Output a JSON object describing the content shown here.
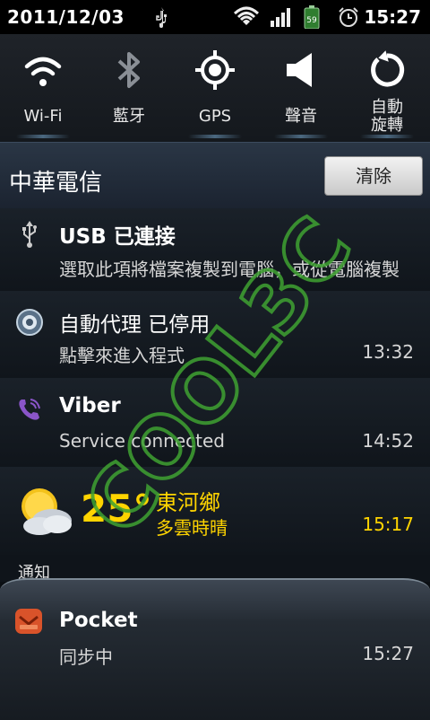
{
  "status_bar": {
    "date": "2011/12/03",
    "battery": "59",
    "time": "15:27"
  },
  "toggles": [
    {
      "label": "Wi-Fi",
      "icon": "wifi-icon"
    },
    {
      "label": "藍牙",
      "icon": "bluetooth-icon"
    },
    {
      "label": "GPS",
      "icon": "gps-icon"
    },
    {
      "label": "聲音",
      "icon": "sound-icon"
    },
    {
      "label": "自動\n旋轉",
      "icon": "rotate-icon"
    }
  ],
  "carrier": {
    "name": "中華電信",
    "clear_label": "清除"
  },
  "notifications": {
    "usb": {
      "title": "USB 已連接",
      "subtitle": "選取此項將檔案複製到電腦，或從電腦複製"
    },
    "proxy": {
      "title": "自動代理 已停用",
      "subtitle": "點擊來進入程式",
      "time": "13:32"
    },
    "viber": {
      "title": "Viber",
      "subtitle": "Service connected",
      "time": "14:52"
    }
  },
  "weather": {
    "temp": "25°",
    "place": "東河鄉",
    "condition": "多雲時晴",
    "time": "15:17"
  },
  "section": {
    "label": "通知"
  },
  "pocket": {
    "title": "Pocket",
    "subtitle": "同步中",
    "time": "15:27"
  },
  "watermark": {
    "text": "COOL3C"
  },
  "colors": {
    "accent_yellow": "#ffd400",
    "watermark_green": "#3fa232",
    "viber_purple": "#8a55c9",
    "pocket_red": "#d9532a"
  }
}
